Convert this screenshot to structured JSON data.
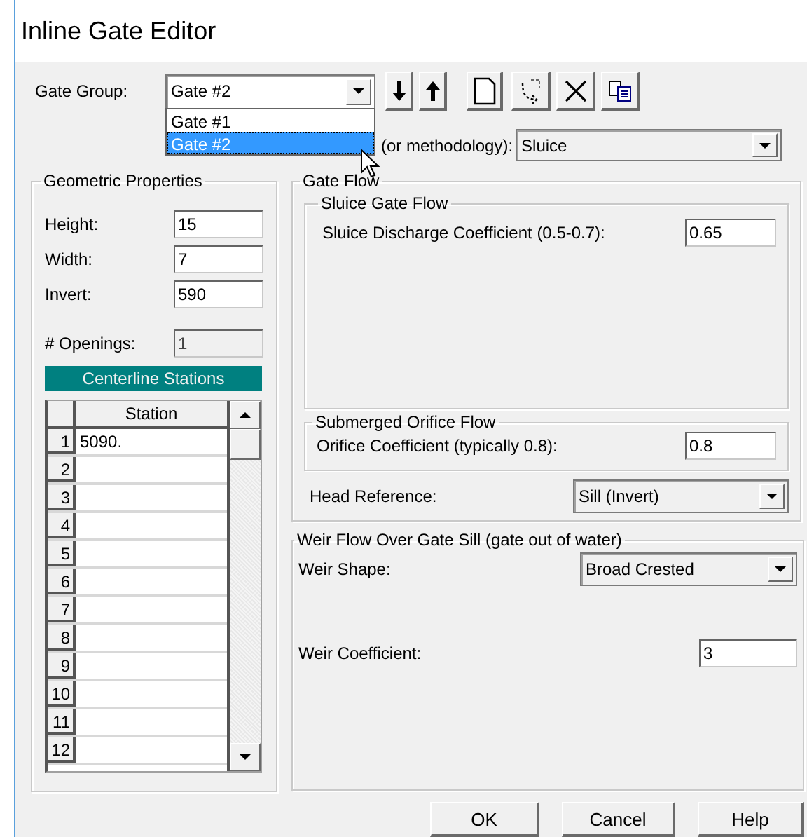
{
  "window": {
    "title": "Inline Gate Editor"
  },
  "gate_group": {
    "label": "Gate Group:",
    "value": "Gate #2",
    "options": [
      {
        "label": "Gate #1",
        "selected": false
      },
      {
        "label": "Gate #2",
        "selected": true
      }
    ]
  },
  "methodology": {
    "label": "(or methodology):",
    "value": "Sluice"
  },
  "geometric": {
    "title": "Geometric Properties",
    "fields": [
      {
        "label": "Height:",
        "value": "15"
      },
      {
        "label": "Width:",
        "value": "7"
      },
      {
        "label": "Invert:",
        "value": "590"
      }
    ],
    "openings": {
      "label": "# Openings:",
      "value": "1",
      "disabled": true
    },
    "stations": {
      "title": "Centerline Stations",
      "column": "Station",
      "rows": [
        {
          "number": "1",
          "value": "5090."
        },
        {
          "number": "2"
        },
        {
          "number": "3"
        },
        {
          "number": "4"
        },
        {
          "number": "5"
        },
        {
          "number": "6"
        },
        {
          "number": "7"
        },
        {
          "number": "8"
        },
        {
          "number": "9"
        },
        {
          "number": "10"
        },
        {
          "number": "11"
        },
        {
          "number": "12"
        }
      ]
    }
  },
  "gate_flow": {
    "title": "Gate Flow",
    "sluice": {
      "title": "Sluice Gate Flow",
      "label": "Sluice Discharge Coefficient (0.5-0.7):",
      "value": "0.65"
    },
    "orifice": {
      "title": "Submerged Orifice Flow",
      "label": "Orifice Coefficient (typically 0.8):",
      "value": "0.8"
    },
    "head_reference": {
      "label": "Head Reference:",
      "value": "Sill (Invert)"
    }
  },
  "weir": {
    "title": "Weir Flow Over Gate Sill (gate out of water)",
    "shape": {
      "label": "Weir Shape:",
      "value": "Broad Crested"
    },
    "coefficient": {
      "label": "Weir Coefficient:",
      "value": "3"
    }
  },
  "buttons": [
    "OK",
    "Cancel",
    "Help"
  ]
}
